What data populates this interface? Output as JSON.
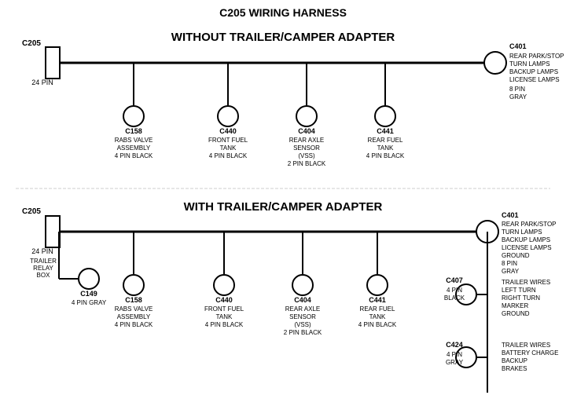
{
  "title": "C205 WIRING HARNESS",
  "section1": {
    "label": "WITHOUT TRAILER/CAMPER ADAPTER",
    "left_connector": {
      "id": "C205",
      "pins": "24 PIN"
    },
    "right_connector": {
      "id": "C401",
      "pins": "8 PIN",
      "color": "GRAY",
      "description": "REAR PARK/STOP\nTURN LAMPS\nBACKUP LAMPS\nLICENSE LAMPS"
    },
    "connectors": [
      {
        "id": "C158",
        "desc": "RABS VALVE\nASSEMBLY\n4 PIN BLACK"
      },
      {
        "id": "C440",
        "desc": "FRONT FUEL\nTANK\n4 PIN BLACK"
      },
      {
        "id": "C404",
        "desc": "REAR AXLE\nSENSOR\n(VSS)\n2 PIN BLACK"
      },
      {
        "id": "C441",
        "desc": "REAR FUEL\nTANK\n4 PIN BLACK"
      }
    ]
  },
  "section2": {
    "label": "WITH TRAILER/CAMPER ADAPTER",
    "left_connector": {
      "id": "C205",
      "pins": "24 PIN"
    },
    "right_connector": {
      "id": "C401",
      "pins": "8 PIN",
      "color": "GRAY",
      "description": "REAR PARK/STOP\nTURN LAMPS\nBACKUP LAMPS\nLICENSE LAMPS\nGROUND"
    },
    "extra_left": {
      "label": "TRAILER\nRELAY\nBOX",
      "id": "C149",
      "pins": "4 PIN GRAY"
    },
    "connectors": [
      {
        "id": "C158",
        "desc": "RABS VALVE\nASSEMBLY\n4 PIN BLACK"
      },
      {
        "id": "C440",
        "desc": "FRONT FUEL\nTANK\n4 PIN BLACK"
      },
      {
        "id": "C404",
        "desc": "REAR AXLE\nSENSOR\n(VSS)\n2 PIN BLACK"
      },
      {
        "id": "C441",
        "desc": "REAR FUEL\nTANK\n4 PIN BLACK"
      }
    ],
    "right_extras": [
      {
        "id": "C407",
        "pins": "4 PIN\nBLACK",
        "desc": "TRAILER WIRES\nLEFT TURN\nRIGHT TURN\nMARKER\nGROUND"
      },
      {
        "id": "C424",
        "pins": "4 PIN\nGRAY",
        "desc": "TRAILER WIRES\nBATTERY CHARGE\nBACKUP\nBRAKES"
      }
    ]
  }
}
